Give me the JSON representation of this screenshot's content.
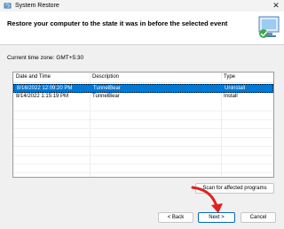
{
  "window": {
    "title": "System Restore"
  },
  "header": {
    "heading": "Restore your computer to the state it was in before the selected event"
  },
  "timezone": {
    "label": "Current time zone: GMT+5:30"
  },
  "table": {
    "columns": [
      "Date and Time",
      "Description",
      "Type"
    ],
    "rows": [
      {
        "date": "8/16/2022 12:09:20 PM",
        "description": "TunnelBear",
        "type": "Uninstall",
        "selected": true
      },
      {
        "date": "8/14/2022 1:15:19 PM",
        "description": "TunnelBear",
        "type": "Install",
        "selected": false
      }
    ]
  },
  "buttons": {
    "scan": "Scan for affected programs",
    "back": "< Back",
    "next": "Next >",
    "cancel": "Cancel"
  },
  "colors": {
    "selection": "#0078d7",
    "annotation_arrow": "#e02020"
  },
  "icons": [
    "system-restore-icon",
    "close-icon",
    "restore-hero-icon",
    "red-arrow-annotation"
  ]
}
